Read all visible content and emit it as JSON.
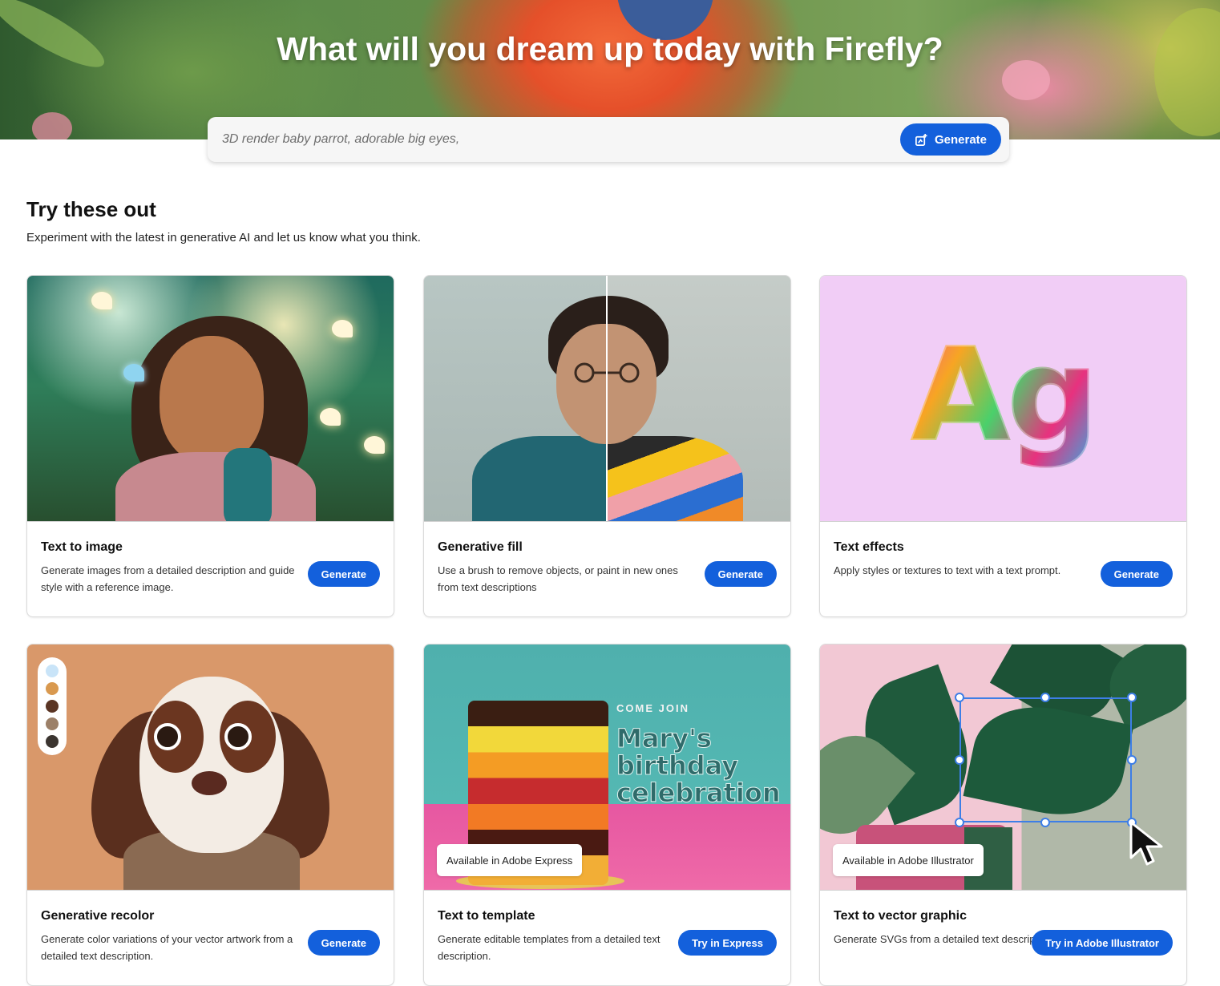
{
  "hero": {
    "title": "What will you dream up today with Firefly?",
    "prompt_placeholder": "3D render baby parrot, adorable big eyes,",
    "generate_label": "Generate"
  },
  "section": {
    "title": "Try these out",
    "subtitle": "Experiment with the latest in generative AI and let us know what you think."
  },
  "cards": [
    {
      "title": "Text to image",
      "description": "Generate images from a detailed description and guide style with a reference image.",
      "button": "Generate",
      "image_icon": "girl-with-butterflies-image"
    },
    {
      "title": "Generative fill",
      "description": "Use a brush to remove objects, or paint in new ones from text descriptions",
      "button": "Generate",
      "image_icon": "man-before-after-image"
    },
    {
      "title": "Text effects",
      "description": "Apply styles or textures to text with a text prompt.",
      "button": "Generate",
      "image_text": "Ag"
    },
    {
      "title": "Generative recolor",
      "description": "Generate color variations of your vector artwork from a detailed text description.",
      "button": "Generate",
      "swatches": [
        "#c9e4f8",
        "#d9994f",
        "#5a3524",
        "#9c8068",
        "#3b3530"
      ]
    },
    {
      "title": "Text to template",
      "description": "Generate editable templates from a detailed text description.",
      "button": "Try in Express",
      "badge": "Available in Adobe Express",
      "image_text_small": "Come join",
      "image_text_big": "Mary's birthday celebration"
    },
    {
      "title": "Text to vector graphic",
      "description": "Generate SVGs from a detailed text description.",
      "button": "Try in Adobe Illustrator",
      "badge": "Available in Adobe Illustrator"
    }
  ],
  "colors": {
    "accent": "#1360dc",
    "card_border": "#dadada"
  }
}
